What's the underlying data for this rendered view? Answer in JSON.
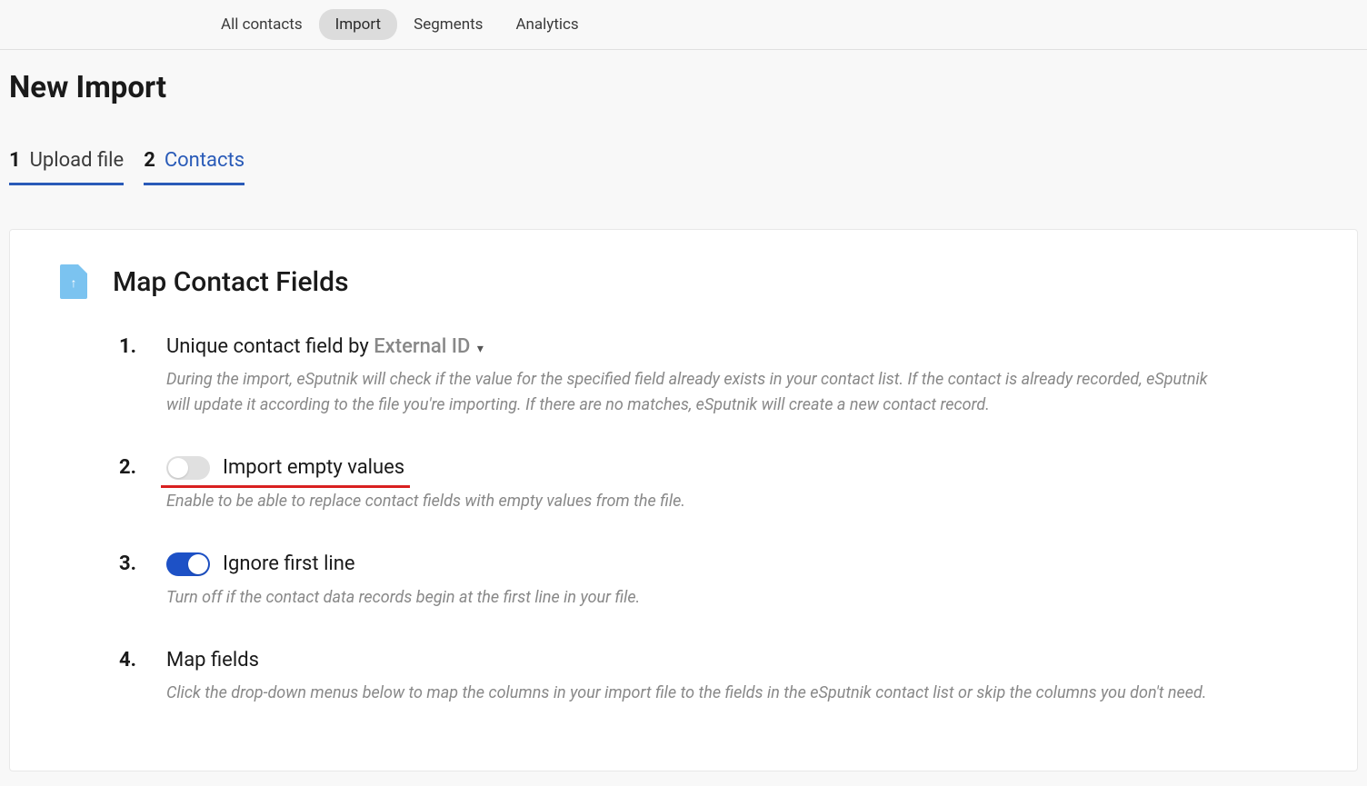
{
  "topTabs": {
    "items": [
      {
        "label": "All contacts"
      },
      {
        "label": "Import"
      },
      {
        "label": "Segments"
      },
      {
        "label": "Analytics"
      }
    ],
    "activeIndex": 1
  },
  "pageTitle": "New Import",
  "stepTabs": {
    "items": [
      {
        "num": "1",
        "label": "Upload file"
      },
      {
        "num": "2",
        "label": "Contacts"
      }
    ],
    "activeIndex": 1
  },
  "card": {
    "title": "Map Contact Fields",
    "options": [
      {
        "num": "1.",
        "labelPrefix": "Unique contact field by ",
        "dropdownValue": "External ID",
        "desc": "During the import, eSputnik will check if the value for the specified field already exists in your contact list. If the contact is already recorded, eSputnik will update it according to the file you're importing. If there are no matches, eSputnik will create a new contact record."
      },
      {
        "num": "2.",
        "toggleOn": false,
        "label": "Import empty values",
        "desc": "Enable to be able to replace contact fields with empty values from the file."
      },
      {
        "num": "3.",
        "toggleOn": true,
        "label": "Ignore first line",
        "desc": "Turn off if the contact data records begin at the first line in your file."
      },
      {
        "num": "4.",
        "label": "Map fields",
        "desc": "Click the drop-down menus below to map the columns in your import file to the fields in the eSputnik contact list or skip the columns you don't need."
      }
    ]
  }
}
